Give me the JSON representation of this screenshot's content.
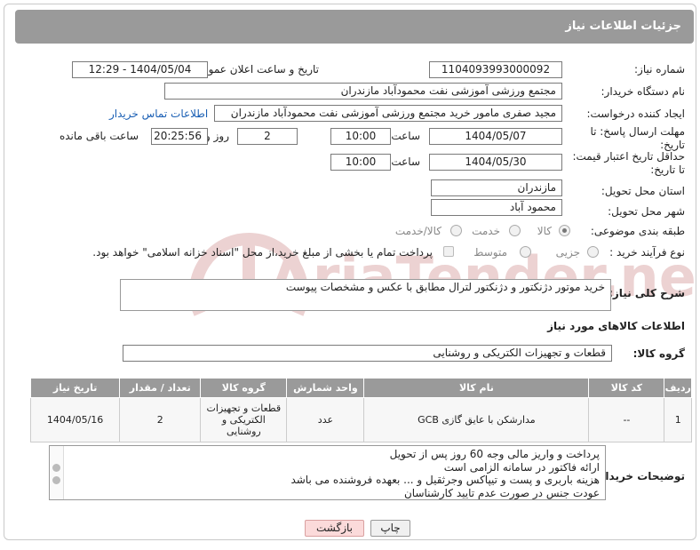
{
  "header": {
    "title": "جزئیات اطلاعات نیاز"
  },
  "fields": {
    "need_number_label": "شماره نیاز:",
    "need_number": "1104093993000092",
    "announce_label": "تاریخ و ساعت اعلان عمومی:",
    "announce_value": "1404/05/04 - 12:29",
    "buyer_org_label": "نام دستگاه خریدار:",
    "buyer_org": "مجتمع ورزشی آموزشی نفت محمودآباد مازندران",
    "creator_label": "ایجاد کننده درخواست:",
    "creator": "مجید صفری مامور خرید مجتمع ورزشی آموزشی نفت محمودآباد مازندران",
    "contact_link": "اطلاعات تماس خریدار",
    "deadline_label_1": "مهلت ارسال پاسخ: تا",
    "deadline_label_2": "تاریخ:",
    "deadline_date": "1404/05/07",
    "time_label": "ساعت",
    "deadline_time": "10:00",
    "days_value": "2",
    "days_label": "روز و",
    "remaining_value": "20:25:56",
    "remaining_label": "ساعت باقی مانده",
    "price_label_1": "حداقل تاریخ اعتبار قیمت:",
    "price_label_2": "تا تاریخ:",
    "price_date": "1404/05/30",
    "price_time": "10:00",
    "province_label": "استان محل تحویل:",
    "province": "مازندران",
    "city_label": "شهر محل تحویل:",
    "city": "محمود آباد",
    "category_label": "طبقه بندی موضوعی:",
    "category_options": [
      "کالا",
      "خدمت",
      "کالا/خدمت"
    ],
    "process_label": "نوع فرآیند خرید :",
    "process_options": [
      "جزیی",
      "متوسط"
    ],
    "payment_note": "پرداخت تمام یا بخشی از مبلغ خرید،از محل \"اسناد خزانه اسلامی\" خواهد بود.",
    "description_label": "شرح کلی نیاز:",
    "description": "خرید موتور دژنکتور و دژنکتور لترال مطابق با عکس و مشخصات پیوست",
    "goods_info_title": "اطلاعات کالاهای مورد نیاز",
    "goods_group_label": "گروه کالا:",
    "goods_group": "قطعات و تجهیزات الکتریکی و روشنایی"
  },
  "table": {
    "headers": [
      "ردیف",
      "کد کالا",
      "نام کالا",
      "واحد شمارش",
      "گروه کالا",
      "تعداد / مقدار",
      "تاریخ نیاز"
    ],
    "rows": [
      [
        "1",
        "--",
        "مدارشکن با عایق گازی GCB",
        "عدد",
        "قطعات و تجهیزات الکتریکی و روشنایی",
        "2",
        "1404/05/16"
      ]
    ]
  },
  "buyer_notes": {
    "label": "توضیحات خریدار:",
    "lines": [
      "پرداخت و واریز مالی وجه 60 روز پس از تحویل",
      "ارائه فاکتور در سامانه الزامی است",
      "هزینه باربری و پست و تیپاکس وجرثقیل و ... بعهده فروشنده می باشد",
      "عودت جنس در صورت عدم تایید کارشناسان"
    ]
  },
  "buttons": {
    "print": "چاپ",
    "back": "بازگشت"
  },
  "watermark": {
    "brand": "AriaTender.neT"
  },
  "colors": {
    "header_bg": "#9a9a9a",
    "link": "#1a5fb4",
    "watermark": "#e8c9c9",
    "back_bg": "#fbdada"
  }
}
